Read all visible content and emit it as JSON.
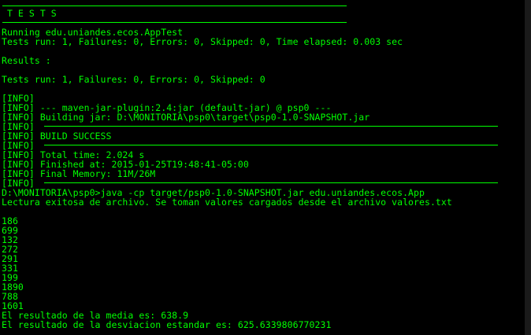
{
  "console": {
    "text_color": "#00ff00",
    "background_color": "#000000",
    "lines": [
      "",
      " T E S T S",
      "",
      "Running edu.uniandes.ecos.AppTest",
      "Tests run: 1, Failures: 0, Errors: 0, Skipped: 0, Time elapsed: 0.003 sec",
      "",
      "Results :",
      "",
      "Tests run: 1, Failures: 0, Errors: 0, Skipped: 0",
      "",
      "[INFO]",
      "[INFO] --- maven-jar-plugin:2.4:jar (default-jar) @ psp0 ---",
      "[INFO] Building jar: D:\\MONITORIA\\psp0\\target\\psp0-1.0-SNAPSHOT.jar",
      "[INFO]",
      "[INFO] BUILD SUCCESS",
      "[INFO]",
      "[INFO] Total time: 2.024 s",
      "[INFO] Finished at: 2015-01-25T19:48:41-05:00",
      "[INFO] Final Memory: 11M/26M",
      "[INFO]",
      "D:\\MONITORIA\\psp0>java -cp target/psp0-1.0-SNAPSHOT.jar edu.uniandes.ecos.App",
      "Lectura exitosa de archivo. Se toman valores cargados desde el archivo valores.txt",
      "",
      "186",
      "699",
      "132",
      "272",
      "291",
      "331",
      "199",
      "1890",
      "788",
      "1601",
      "El resultado de la media es: 638.9",
      "El resultado de la desviacion estandar es: 625.6339806770231"
    ]
  }
}
